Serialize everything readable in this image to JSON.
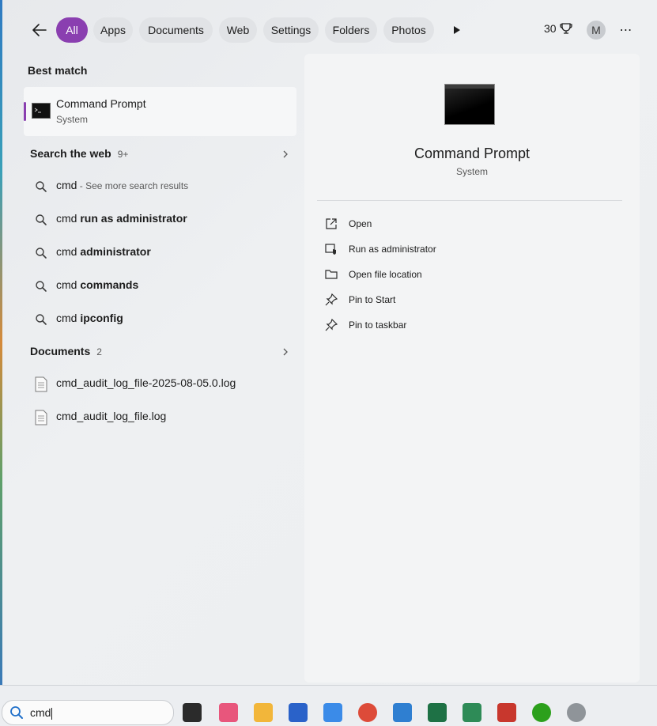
{
  "filters": {
    "tabs": [
      {
        "label": "All",
        "active": true
      },
      {
        "label": "Apps"
      },
      {
        "label": "Documents"
      },
      {
        "label": "Web"
      },
      {
        "label": "Settings"
      },
      {
        "label": "Folders"
      },
      {
        "label": "Photos"
      }
    ],
    "points": "30",
    "avatar_initial": "M"
  },
  "best_match": {
    "heading": "Best match",
    "title": "Command Prompt",
    "subtitle": "System"
  },
  "web": {
    "heading": "Search the web",
    "count": "9+",
    "results": [
      {
        "prefix": "cmd",
        "suffix": "",
        "note": " - See more search results"
      },
      {
        "prefix": "cmd ",
        "suffix": "run as administrator",
        "note": ""
      },
      {
        "prefix": "cmd ",
        "suffix": "administrator",
        "note": ""
      },
      {
        "prefix": "cmd ",
        "suffix": "commands",
        "note": ""
      },
      {
        "prefix": "cmd ",
        "suffix": "ipconfig",
        "note": ""
      }
    ]
  },
  "documents": {
    "heading": "Documents",
    "count": "2",
    "files": [
      {
        "name": "cmd_audit_log_file-2025-08-05.0.log"
      },
      {
        "name": "cmd_audit_log_file.log"
      }
    ]
  },
  "detail": {
    "title": "Command Prompt",
    "subtitle": "System",
    "actions": [
      {
        "label": "Open",
        "icon": "open-external-icon"
      },
      {
        "label": "Run as administrator",
        "icon": "shield-admin-icon"
      },
      {
        "label": "Open file location",
        "icon": "folder-icon"
      },
      {
        "label": "Pin to Start",
        "icon": "pin-icon"
      },
      {
        "label": "Pin to taskbar",
        "icon": "pin-icon"
      }
    ]
  },
  "taskbar": {
    "search_value": "cmd",
    "apps": [
      {
        "name": "task-view-icon",
        "color": "#2b2b2b"
      },
      {
        "name": "copilot-icon",
        "color": "#e8567c"
      },
      {
        "name": "file-explorer-icon",
        "color": "#f2b63a"
      },
      {
        "name": "microsoft-store-icon",
        "color": "#2a62c9"
      },
      {
        "name": "microsoft-365-icon",
        "color": "#3b8be8"
      },
      {
        "name": "chrome-icon",
        "color": "#dd4b39"
      },
      {
        "name": "photos-icon",
        "color": "#2f7fd1"
      },
      {
        "name": "excel-icon",
        "color": "#1e7145"
      },
      {
        "name": "excel-sync-icon",
        "color": "#2e8b57"
      },
      {
        "name": "snipping-tool-icon",
        "color": "#c8372d"
      },
      {
        "name": "quickbooks-icon",
        "color": "#2ca01c"
      },
      {
        "name": "app-drop-icon",
        "color": "#8f9499"
      }
    ]
  }
}
